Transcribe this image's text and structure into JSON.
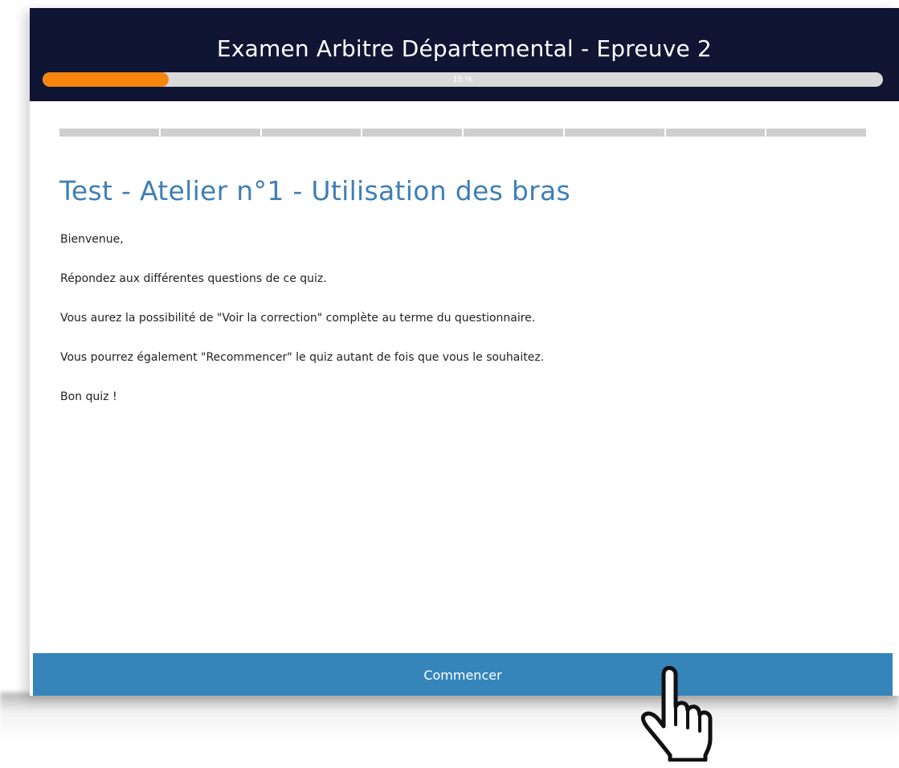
{
  "header": {
    "title": "Examen Arbitre Départemental - Epreuve 2",
    "progress_percent": 15,
    "progress_label": "15 %"
  },
  "steps": {
    "count": 8
  },
  "quiz": {
    "title": "Test - Atelier n°1 - Utilisation des bras",
    "paragraphs": [
      "Bienvenue,",
      "Répondez aux différentes questions de ce quiz.",
      "Vous aurez la possibilité de \"Voir la correction\" complète au terme du questionnaire.",
      "Vous pourrez également \"Recommencer\" le quiz autant de fois que vous le souhaitez.",
      "Bon quiz !"
    ]
  },
  "footer": {
    "start_label": "Commencer"
  },
  "colors": {
    "header_bg": "#0f1533",
    "progress_fill": "#f7860f",
    "title_blue": "#3f7fb6",
    "button_blue": "#3585bb"
  },
  "icons": {
    "cursor": "hand-pointer-icon"
  }
}
